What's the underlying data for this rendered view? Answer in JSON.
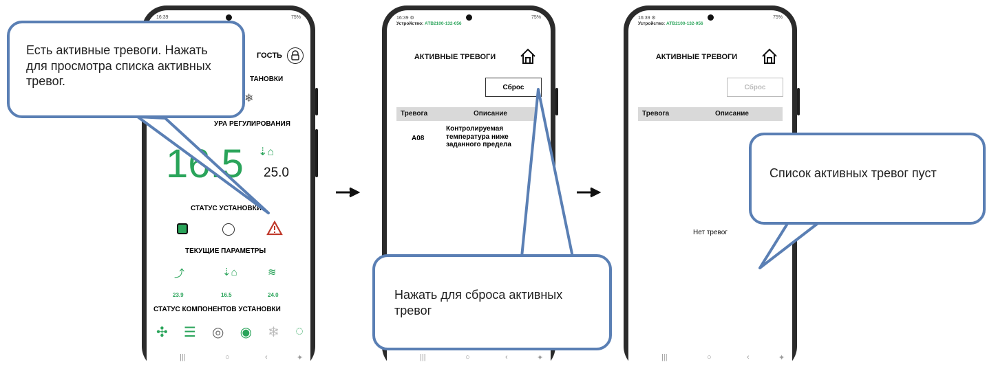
{
  "screen1": {
    "guest_label": "ГОСТЬ",
    "heading_partial1": "ТАНОВКИ",
    "heading_partial2": "УРА РЕГУЛИРОВАНИЯ",
    "big_temp": "16.5",
    "setpoint": "25.0",
    "status_title": "СТАТУС УСТАНОВКИ",
    "params_title": "ТЕКУЩИЕ ПАРАМЕТРЫ",
    "params": [
      "23.9",
      "16.5",
      "24.0"
    ],
    "components_title": "СТАТУС КОМПОНЕНТОВ УСТАНОВКИ"
  },
  "screen2": {
    "time": "16:39",
    "signal": "75%",
    "device_label": "Устройство:",
    "device_id": "АТВ2100-132-056",
    "title": "АКТИВНЫЕ ТРЕВОГИ",
    "reset_label": "Сброс",
    "col_alarm": "Тревога",
    "col_desc": "Описание",
    "alarm_code": "A08",
    "alarm_desc": "Контролируемая температура ниже заданного предела"
  },
  "screen3": {
    "time": "16:39",
    "signal": "75%",
    "device_label": "Устройство:",
    "device_id": "АТВ2100-132-056",
    "title": "АКТИВНЫЕ ТРЕВОГИ",
    "reset_label": "Сброс",
    "col_alarm": "Тревога",
    "col_desc": "Описание",
    "empty_text": "Нет тревог"
  },
  "callouts": {
    "c1": "Есть активные тревоги. Нажать для просмотра списка активных тревог.",
    "c2": "Нажать для сброса активных тревог",
    "c3": "Список активных тревог пуст"
  },
  "colors": {
    "accent_green": "#2aa45a",
    "callout_border": "#5a7fb4",
    "alarm_red": "#c0392b"
  }
}
